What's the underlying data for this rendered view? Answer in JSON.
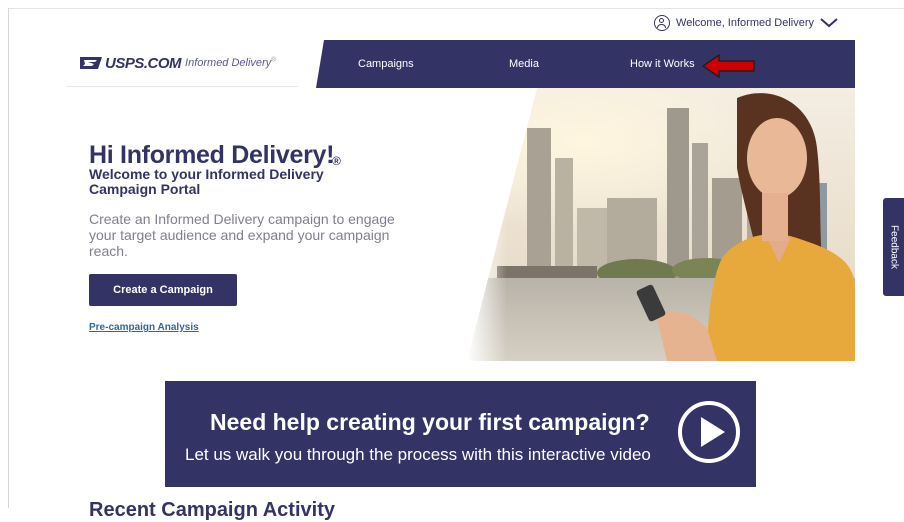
{
  "header": {
    "welcome_text": "Welcome, Informed Delivery"
  },
  "logo": {
    "brand": "USPS.COM",
    "product": "Informed Delivery",
    "reg": "®"
  },
  "nav": {
    "items": [
      {
        "label": "Campaigns"
      },
      {
        "label": "Media"
      },
      {
        "label": "How it Works"
      }
    ],
    "annotation_arrow_color": "#cc0000"
  },
  "hero": {
    "title": "Hi Informed Delivery!",
    "reg_mark": "®",
    "subtitle": "Welcome to your Informed Delivery Campaign Portal",
    "description": "Create an Informed Delivery campaign to engage your target audience and expand your campaign reach.",
    "create_button": "Create a Campaign",
    "pre_campaign_link": "Pre-campaign Analysis"
  },
  "feedback": {
    "label": "Feedback"
  },
  "video_banner": {
    "title": "Need help creating your first campaign?",
    "subtitle": "Let us walk you through the process with this interactive video"
  },
  "recent": {
    "heading": "Recent Campaign Activity"
  },
  "colors": {
    "brand_navy": "#333366",
    "link_blue": "#336699",
    "annotation_red": "#cc0000"
  }
}
